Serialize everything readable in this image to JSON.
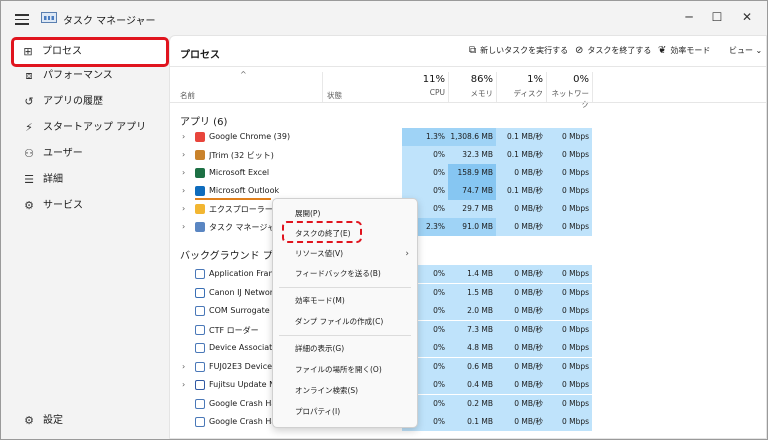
{
  "window": {
    "title": "タスク マネージャー",
    "minimize_glyph": "─",
    "maximize_glyph": "☐",
    "close_glyph": "✕"
  },
  "sidebar": {
    "items": [
      {
        "label": "プロセス",
        "icon": "processes-icon",
        "glyph": "⊞",
        "active": true
      },
      {
        "label": "パフォーマンス",
        "icon": "performance-icon",
        "glyph": "⧈"
      },
      {
        "label": "アプリの履歴",
        "icon": "app-history-icon",
        "glyph": "↺"
      },
      {
        "label": "スタートアップ アプリ",
        "icon": "startup-icon",
        "glyph": "⚡"
      },
      {
        "label": "ユーザー",
        "icon": "users-icon",
        "glyph": "⚇"
      },
      {
        "label": "詳細",
        "icon": "details-icon",
        "glyph": "☰"
      },
      {
        "label": "サービス",
        "icon": "services-icon",
        "glyph": "⚙"
      }
    ],
    "settings": {
      "label": "設定",
      "icon": "settings-icon",
      "glyph": "⚙"
    }
  },
  "main": {
    "title": "プロセス",
    "toolbar": {
      "new_task": "新しいタスクを実行する",
      "end_task": "タスクを終了する",
      "efficiency": "効率モード",
      "view": "ビュー"
    },
    "columns": {
      "name": "名前",
      "status": "状態",
      "cpu": {
        "pct": "11%",
        "label": "CPU"
      },
      "memory": {
        "pct": "86%",
        "label": "メモリ"
      },
      "disk": {
        "pct": "1%",
        "label": "ディスク"
      },
      "network": {
        "pct": "0%",
        "label": "ネットワーク"
      }
    },
    "apps_group": "アプリ (6)",
    "background_group": "バックグラウンド プロセス",
    "apps": [
      {
        "name": "Google Chrome (39)",
        "cpu": "1.3%",
        "mem": "1,308.6 MB",
        "disk": "0.1 MB/秒",
        "net": "0 Mbps",
        "color": "#e8453c"
      },
      {
        "name": "JTrim (32 ビット)",
        "cpu": "0%",
        "mem": "32.3 MB",
        "disk": "0.1 MB/秒",
        "net": "0 Mbps",
        "color": "#c9822b"
      },
      {
        "name": "Microsoft Excel",
        "cpu": "0%",
        "mem": "158.9 MB",
        "disk": "0 MB/秒",
        "net": "0 Mbps",
        "color": "#1d7044"
      },
      {
        "name": "Microsoft Outlook",
        "cpu": "0%",
        "mem": "74.7 MB",
        "disk": "0.1 MB/秒",
        "net": "0 Mbps",
        "color": "#0f6cbd"
      },
      {
        "name": "エクスプローラー",
        "cpu": "0%",
        "mem": "29.7 MB",
        "disk": "0 MB/秒",
        "net": "0 Mbps",
        "color": "#f2b632"
      },
      {
        "name": "タスク マネージャー",
        "cpu": "2.3%",
        "mem": "91.0 MB",
        "disk": "0 MB/秒",
        "net": "0 Mbps",
        "color": "#5a86c2"
      }
    ],
    "background": [
      {
        "name": "Application Frame",
        "cpu": "0%",
        "mem": "1.4 MB",
        "disk": "0 MB/秒",
        "net": "0 Mbps"
      },
      {
        "name": "Canon IJ Network S",
        "cpu": "0%",
        "mem": "1.5 MB",
        "disk": "0 MB/秒",
        "net": "0 Mbps"
      },
      {
        "name": "COM Surrogate",
        "cpu": "0%",
        "mem": "2.0 MB",
        "disk": "0 MB/秒",
        "net": "0 Mbps"
      },
      {
        "name": "CTF ローダー",
        "cpu": "0%",
        "mem": "7.3 MB",
        "disk": "0 MB/秒",
        "net": "0 Mbps"
      },
      {
        "name": "Device Associatio",
        "cpu": "0%",
        "mem": "4.8 MB",
        "disk": "0 MB/秒",
        "net": "0 Mbps"
      },
      {
        "name": "FUJ02E3 Device Dr",
        "cpu": "0%",
        "mem": "0.6 MB",
        "disk": "0 MB/秒",
        "net": "0 Mbps"
      },
      {
        "name": "Fujitsu Update Nav",
        "cpu": "0%",
        "mem": "0.4 MB",
        "disk": "0 MB/秒",
        "net": "0 Mbps"
      },
      {
        "name": "Google Crash Han",
        "cpu": "0%",
        "mem": "0.2 MB",
        "disk": "0 MB/秒",
        "net": "0 Mbps"
      },
      {
        "name": "Google Crash Han",
        "cpu": "0%",
        "mem": "0.1 MB",
        "disk": "0 MB/秒",
        "net": "0 Mbps"
      }
    ]
  },
  "context_menu": {
    "items": [
      "展開(P)",
      "タスクの終了(E)",
      "リソース値(V)",
      "フィードバックを送る(B)",
      "効率モード(M)",
      "ダンプ ファイルの作成(C)",
      "詳細の表示(G)",
      "ファイルの場所を開く(O)",
      "オンライン検索(S)",
      "プロパティ(I)"
    ]
  }
}
